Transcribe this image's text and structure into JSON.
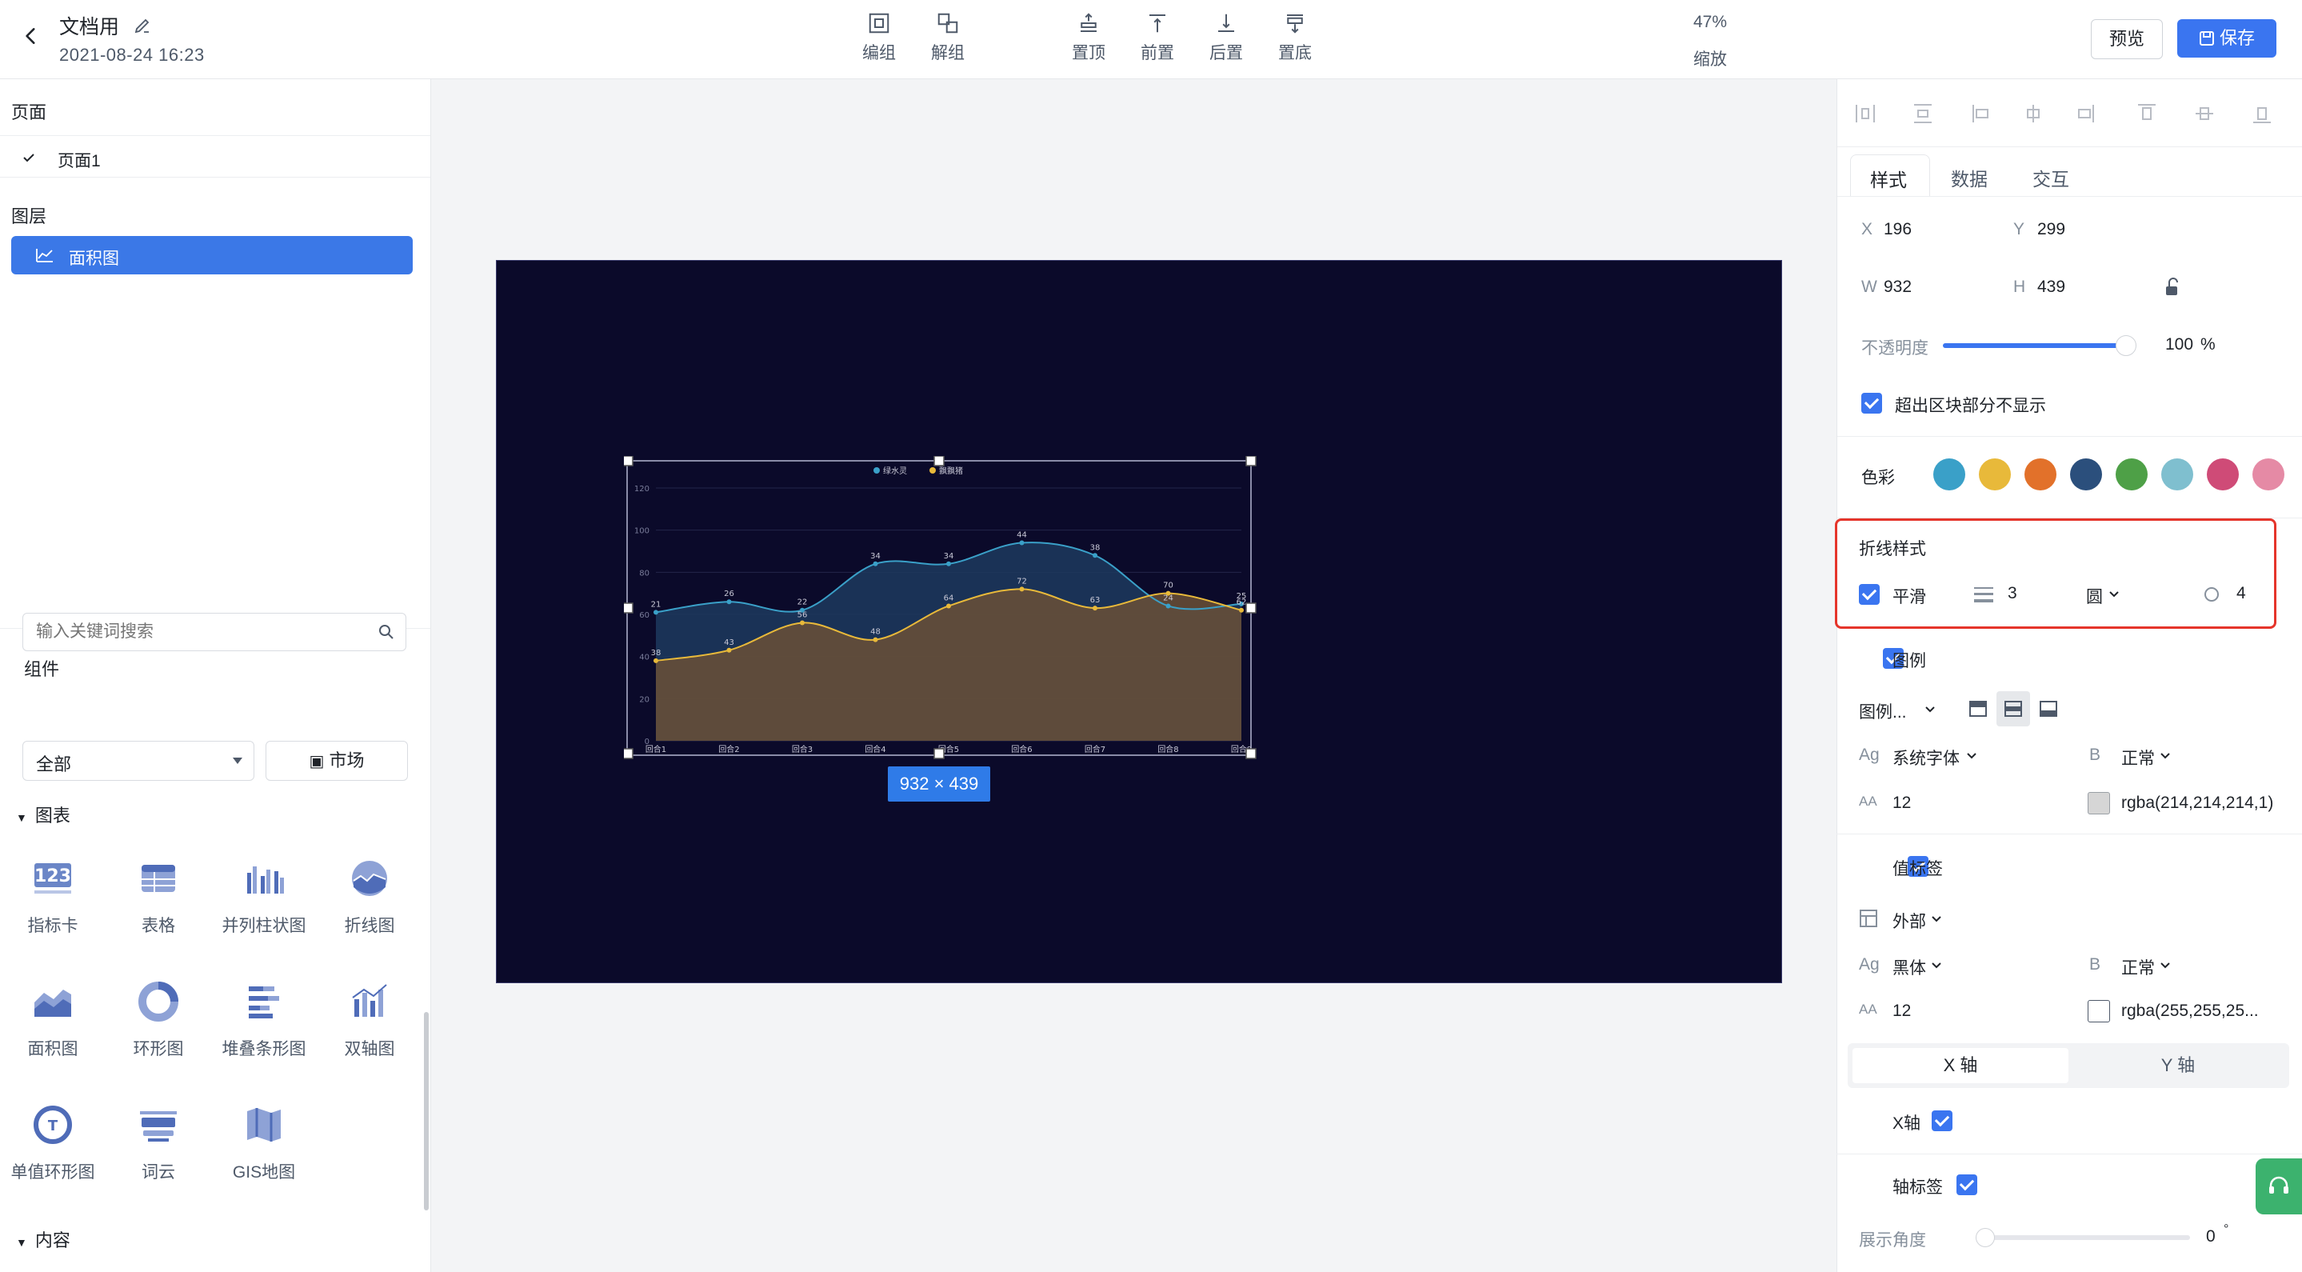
{
  "header": {
    "doc_title": "文档用",
    "doc_time": "2021-08-24 16:23",
    "tools": [
      {
        "label": "编组",
        "icon": "group-icon"
      },
      {
        "label": "解组",
        "icon": "ungroup-icon"
      },
      {
        "label": "置顶",
        "icon": "bring-to-top-icon"
      },
      {
        "label": "前置",
        "icon": "bring-forward-icon"
      },
      {
        "label": "后置",
        "icon": "send-backward-icon"
      },
      {
        "label": "置底",
        "icon": "send-to-bottom-icon"
      }
    ],
    "zoom_value": "47%",
    "zoom_label": "缩放",
    "preview_label": "预览",
    "save_label": "保存"
  },
  "left": {
    "pages_title": "页面",
    "page_item": "页面1",
    "layers_title": "图层",
    "layer_item": "面积图",
    "components_title": "组件",
    "search_placeholder": "输入关键词搜索",
    "category_select": "全部",
    "market_label": "市场",
    "chart_group": "图表",
    "content_group": "内容",
    "components": [
      {
        "label": "指标卡"
      },
      {
        "label": "表格"
      },
      {
        "label": "并列柱状图"
      },
      {
        "label": "折线图"
      },
      {
        "label": "面积图"
      },
      {
        "label": "环形图"
      },
      {
        "label": "堆叠条形图"
      },
      {
        "label": "双轴图"
      },
      {
        "label": "单值环形图"
      },
      {
        "label": "词云"
      },
      {
        "label": "GIS地图"
      }
    ]
  },
  "canvas": {
    "size_badge": "932 × 439",
    "bg_color": "#0b0a2a"
  },
  "chart_data": {
    "type": "area",
    "categories": [
      "回合1",
      "回合2",
      "回合3",
      "回合4",
      "回合5",
      "回合6",
      "回合7",
      "回合8",
      "回合9"
    ],
    "series": [
      {
        "name": "绿水灵",
        "color": "#3aa0c8",
        "values": [
          21,
          26,
          22,
          34,
          34,
          44,
          38,
          24,
          25
        ]
      },
      {
        "name": "飘飘猪",
        "color": "#e8b93a",
        "values": [
          38,
          43,
          56,
          48,
          64,
          72,
          63,
          70,
          62
        ]
      }
    ],
    "y_ticks": [
      "0",
      "20",
      "40",
      "60",
      "80",
      "100",
      "120"
    ],
    "legend": "top-center",
    "smooth": true
  },
  "right": {
    "tabs": [
      "样式",
      "数据",
      "交互"
    ],
    "x_label": "X",
    "x_value": "196",
    "y_label": "Y",
    "y_value": "299",
    "w_label": "W",
    "w_value": "932",
    "h_label": "H",
    "h_value": "439",
    "opacity_label": "不透明度",
    "opacity_value": "100",
    "opacity_unit": "%",
    "overflow_label": "超出区块部分不显示",
    "color_label": "色彩",
    "swatches": [
      "#3aa0c8",
      "#e8b93a",
      "#e2712a",
      "#2b4f7c",
      "#4ea047",
      "#7fbfcf",
      "#cf4b77",
      "#e58aa5"
    ],
    "line_style_title": "折线样式",
    "smooth_label": "平滑",
    "line_width": "3",
    "marker_shape": "圆",
    "marker_size": "4",
    "legend_label": "图例",
    "legend_pos": "图例...",
    "font_family": "系统字体",
    "font_weight": "正常",
    "font_size": "12",
    "font_color": "rgba(214,214,214,1)",
    "value_label": "值标签",
    "value_pos": "外部",
    "value_font": "黑体",
    "value_weight": "正常",
    "value_size": "12",
    "value_color": "rgba(255,255,25...",
    "axis_tabs": [
      "X 轴",
      "Y 轴"
    ],
    "x_axis_label": "X轴",
    "axis_tick_label": "轴标签",
    "angle_label": "展示角度",
    "angle_value": "0",
    "angle_unit": "°"
  }
}
